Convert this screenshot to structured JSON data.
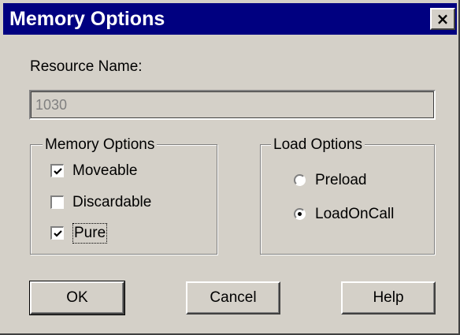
{
  "window": {
    "title": "Memory Options",
    "close_label": "×"
  },
  "resource": {
    "label": "Resource Name:",
    "value": "1030"
  },
  "memory_options": {
    "title": "Memory Options",
    "items": [
      {
        "label": "Moveable",
        "checked": true
      },
      {
        "label": "Discardable",
        "checked": false
      },
      {
        "label": "Pure",
        "checked": true
      }
    ]
  },
  "load_options": {
    "title": "Load Options",
    "items": [
      {
        "label": "Preload",
        "selected": false
      },
      {
        "label": "LoadOnCall",
        "selected": true
      }
    ]
  },
  "buttons": {
    "ok": "OK",
    "cancel": "Cancel",
    "help": "Help"
  }
}
